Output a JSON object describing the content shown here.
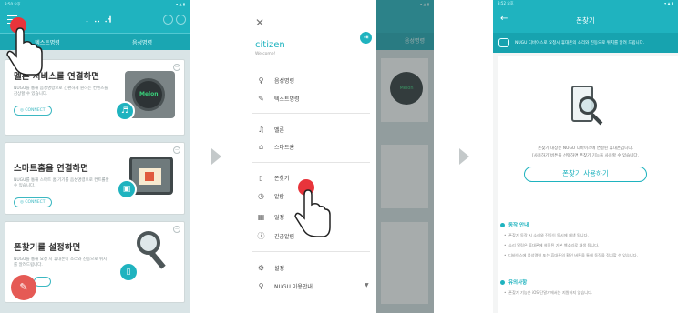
{
  "screen1": {
    "status_left": "3:50 오후",
    "logo": "ᆞᆢᆟ",
    "tabs": [
      "텍스트명령",
      "음성명령"
    ],
    "cards": [
      {
        "title": "멜론 서비스를 연결하면",
        "desc": "NUGU를 통해 음성명령으로 간편하게 원하는 컨텐츠를 감상할 수 있습니다.",
        "button": "CONNECT",
        "brand": "Melon"
      },
      {
        "title": "스마트홈을 연결하면",
        "desc": "NUGU를 통해 스마트 홈 기기를 음성명령으로 컨트롤할 수 있습니다.",
        "button": "CONNECT"
      },
      {
        "title": "폰찾기를 설정하면",
        "desc": "NUGU를 통해 요청 시 휴대폰이 소리와 진동으로 위치를 알려드립니다.",
        "button": ""
      }
    ]
  },
  "screen2": {
    "status_left": "2:50 오후",
    "user_name": "citizen",
    "user_sub": "Welcome!",
    "menu": [
      {
        "label": "음성명령",
        "icon": "mic-icon"
      },
      {
        "label": "텍스트명령",
        "icon": "edit-icon"
      },
      {
        "label": "멜론",
        "icon": "music-icon"
      },
      {
        "label": "스마트홈",
        "icon": "home-icon"
      },
      {
        "label": "폰찾기",
        "icon": "phone-icon"
      },
      {
        "label": "알람",
        "icon": "alarm-icon"
      },
      {
        "label": "일정",
        "icon": "calendar-icon"
      },
      {
        "label": "긴급알림",
        "icon": "alert-icon"
      },
      {
        "label": "설정",
        "icon": "gear-icon"
      },
      {
        "label": "NUGU 이용안내",
        "icon": "info-icon"
      }
    ],
    "bg_tab": "음성명령"
  },
  "screen3": {
    "status_left": "3:52 오후",
    "title": "폰찾기",
    "notice": "NUGU 디바이스로 요청시 휴대폰의 소리와 진동으로 위치를 알려 드립니다.",
    "desc_line1": "폰찾기 대상은 NUGU 디바이스에 연결된 휴대폰입니다.",
    "desc_line2": "[사용하기]버튼을 선택하면 폰찾기 기능을 사용할 수 있습니다.",
    "button": "폰찾기 사용하기",
    "section1": "동작 안내",
    "bullets1": [
      "폰찾기 동작 시 소리와 진동이 동시에 재생 됩니다.",
      "소리 알림은 휴대폰에 설정된 기본 벨소리로 재생 됩니다.",
      "디바이스에 음성명령 또는 휴대폰의 확인 버튼을 통해 동작을 정지할 수 있습니다."
    ],
    "section2": "유의사항",
    "bullets2": [
      "폰찾기 기능은 iOS 단말기에서는 지원하지 않습니다."
    ]
  },
  "colors": {
    "accent": "#1fb3bf",
    "tap": "#e8343b"
  }
}
